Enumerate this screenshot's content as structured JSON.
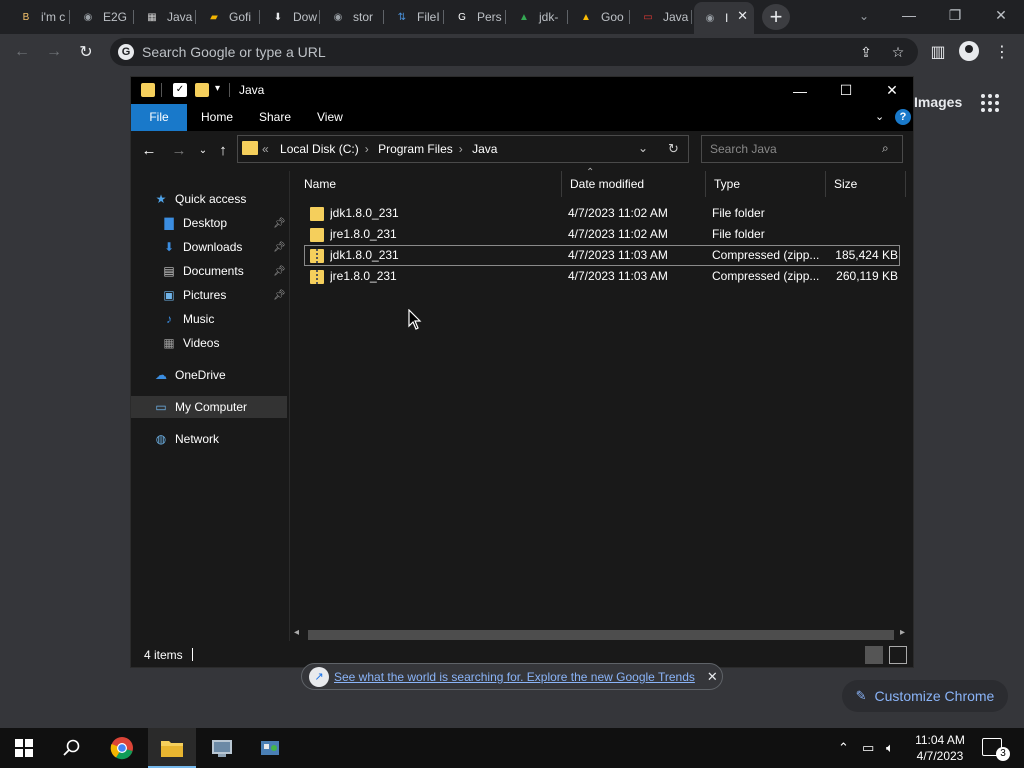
{
  "tabs": [
    {
      "title": "i'm c",
      "color": "#f5c26b",
      "glyph": "B"
    },
    {
      "title": "E2G",
      "color": "#9aa0a6",
      "glyph": "◉"
    },
    {
      "title": "Java",
      "color": "#d0d0d0",
      "glyph": "▦"
    },
    {
      "title": "Gofi",
      "color": "#f2b400",
      "glyph": "▰"
    },
    {
      "title": "Dow",
      "color": "#e8eaed",
      "glyph": "⬇"
    },
    {
      "title": "stor",
      "color": "#9aa0a6",
      "glyph": "◉"
    },
    {
      "title": "FileI",
      "color": "#4a90d9",
      "glyph": "⇅"
    },
    {
      "title": "Pers",
      "color": "#ffffff",
      "glyph": "G"
    },
    {
      "title": "jdk-",
      "color": "#34a853",
      "glyph": "▲"
    },
    {
      "title": "Goo",
      "color": "#fbbc04",
      "glyph": "▲"
    },
    {
      "title": "Java",
      "color": "#e53935",
      "glyph": "▭"
    },
    {
      "title": "I",
      "color": "#9aa0a6",
      "glyph": "◉"
    }
  ],
  "omnibox": {
    "placeholder": "Search Google or type a URL"
  },
  "page": {
    "images_link": "Images",
    "trends_text": "See what the world is searching for. Explore the new Google Trends",
    "customize_label": "Customize Chrome"
  },
  "explorer": {
    "title": "Java",
    "ribbon_tabs": [
      "File",
      "Home",
      "Share",
      "View"
    ],
    "address": {
      "prefix": "«",
      "crumbs": [
        "Local Disk (C:)",
        "Program Files",
        "Java"
      ]
    },
    "search_placeholder": "Search Java",
    "nav": [
      {
        "label": "Quick access",
        "icon": "star-icon",
        "glyph": "★",
        "color": "#4fa3e8",
        "pinned": false
      },
      {
        "label": "Desktop",
        "icon": "desktop-icon",
        "glyph": "▇",
        "color": "#3b8de0",
        "pinned": true
      },
      {
        "label": "Downloads",
        "icon": "download-icon",
        "glyph": "⬇",
        "color": "#3b8de0",
        "pinned": true
      },
      {
        "label": "Documents",
        "icon": "document-icon",
        "glyph": "▤",
        "color": "#c9c9c9",
        "pinned": true
      },
      {
        "label": "Pictures",
        "icon": "picture-icon",
        "glyph": "▣",
        "color": "#6fb3e8",
        "pinned": true
      },
      {
        "label": "Music",
        "icon": "music-icon",
        "glyph": "♪",
        "color": "#3b8de0",
        "pinned": false
      },
      {
        "label": "Videos",
        "icon": "video-icon",
        "glyph": "▦",
        "color": "#9a9a9a",
        "pinned": false
      },
      {
        "label": "OneDrive",
        "icon": "cloud-icon",
        "glyph": "☁",
        "color": "#3b8de0",
        "pinned": false
      },
      {
        "label": "My Computer",
        "icon": "computer-icon",
        "glyph": "▭",
        "color": "#6fb3e8",
        "pinned": false
      },
      {
        "label": "Network",
        "icon": "network-icon",
        "glyph": "◍",
        "color": "#6fb3e8",
        "pinned": false
      }
    ],
    "columns": [
      "Name",
      "Date modified",
      "Type",
      "Size"
    ],
    "files": [
      {
        "name": "jdk1.8.0_231",
        "date": "4/7/2023 11:02 AM",
        "type": "File folder",
        "size": "",
        "kind": "folder"
      },
      {
        "name": "jre1.8.0_231",
        "date": "4/7/2023 11:02 AM",
        "type": "File folder",
        "size": "",
        "kind": "folder"
      },
      {
        "name": "jdk1.8.0_231",
        "date": "4/7/2023 11:03 AM",
        "type": "Compressed (zipp...",
        "size": "185,424 KB",
        "kind": "zip"
      },
      {
        "name": "jre1.8.0_231",
        "date": "4/7/2023 11:03 AM",
        "type": "Compressed (zipp...",
        "size": "260,119 KB",
        "kind": "zip"
      }
    ],
    "status": "4 items"
  },
  "taskbar": {
    "time": "11:04 AM",
    "date": "4/7/2023",
    "notification_count": "3"
  },
  "colors": {
    "accent": "#1979ca",
    "folder": "#f5cf5c",
    "link": "#8ab4f8"
  }
}
